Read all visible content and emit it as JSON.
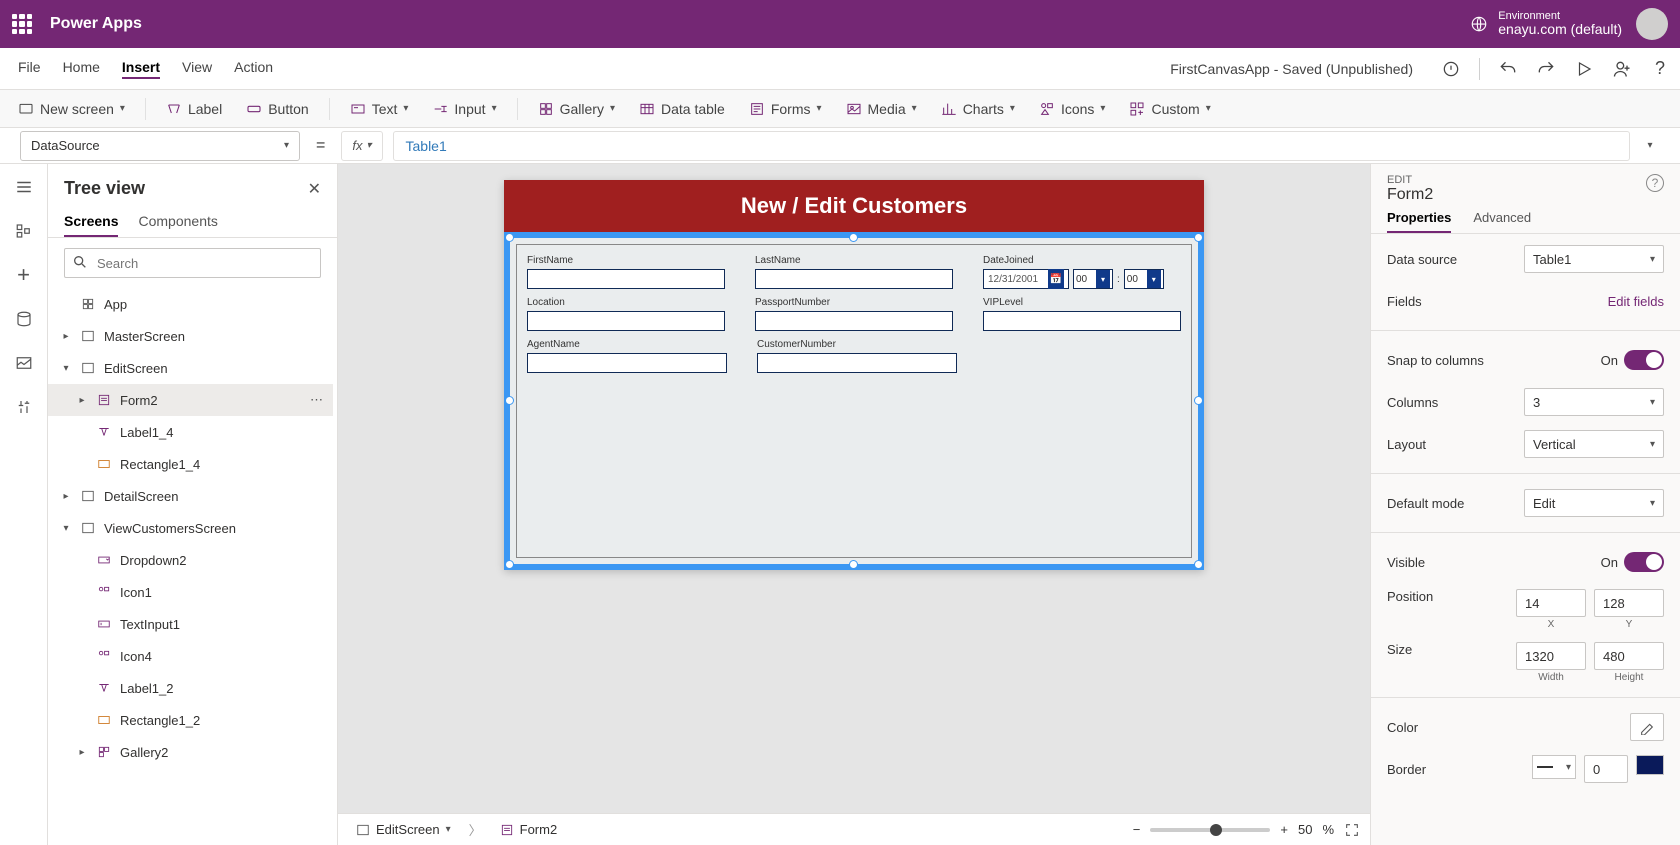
{
  "header": {
    "app": "Power Apps",
    "env_label": "Environment",
    "env_name": "enayu.com (default)"
  },
  "menu": {
    "tabs": [
      "File",
      "Home",
      "Insert",
      "View",
      "Action"
    ],
    "active_index": 2,
    "app_status": "FirstCanvasApp - Saved (Unpublished)"
  },
  "ribbon": {
    "new_screen": "New screen",
    "label": "Label",
    "button": "Button",
    "text": "Text",
    "input": "Input",
    "gallery": "Gallery",
    "data_table": "Data table",
    "forms": "Forms",
    "media": "Media",
    "charts": "Charts",
    "icons": "Icons",
    "custom": "Custom"
  },
  "formula": {
    "property": "DataSource",
    "value": "Table1"
  },
  "tree": {
    "title": "Tree view",
    "tabs": [
      "Screens",
      "Components"
    ],
    "search_placeholder": "Search",
    "items": {
      "app": "App",
      "master": "MasterScreen",
      "edit": "EditScreen",
      "form2": "Form2",
      "label14": "Label1_4",
      "rect14": "Rectangle1_4",
      "detail": "DetailScreen",
      "view": "ViewCustomersScreen",
      "dropdown2": "Dropdown2",
      "icon1": "Icon1",
      "textinput1": "TextInput1",
      "icon4": "Icon4",
      "label12": "Label1_2",
      "rect12": "Rectangle1_2",
      "gallery2": "Gallery2"
    }
  },
  "canvas": {
    "title": "New / Edit Customers",
    "fields": {
      "first_name": "FirstName",
      "last_name": "LastName",
      "date_joined": "DateJoined",
      "date_value": "12/31/2001",
      "hour": "00",
      "minute": "00",
      "location": "Location",
      "passport": "PassportNumber",
      "vip": "VIPLevel",
      "agent": "AgentName",
      "custnum": "CustomerNumber"
    },
    "breadcrumb": {
      "screen": "EditScreen",
      "control": "Form2"
    },
    "zoom": "50",
    "zoom_unit": "%"
  },
  "props": {
    "edit_label": "EDIT",
    "control_name": "Form2",
    "tabs": [
      "Properties",
      "Advanced"
    ],
    "data_source_label": "Data source",
    "data_source_value": "Table1",
    "fields_label": "Fields",
    "edit_fields": "Edit fields",
    "snap_label": "Snap to columns",
    "on": "On",
    "columns_label": "Columns",
    "columns_value": "3",
    "layout_label": "Layout",
    "layout_value": "Vertical",
    "default_mode_label": "Default mode",
    "default_mode_value": "Edit",
    "visible_label": "Visible",
    "position_label": "Position",
    "pos_x": "14",
    "pos_y": "128",
    "x_label": "X",
    "y_label": "Y",
    "size_label": "Size",
    "width": "1320",
    "height": "480",
    "width_label": "Width",
    "height_label": "Height",
    "color_label": "Color",
    "border_label": "Border",
    "border_width": "0"
  }
}
